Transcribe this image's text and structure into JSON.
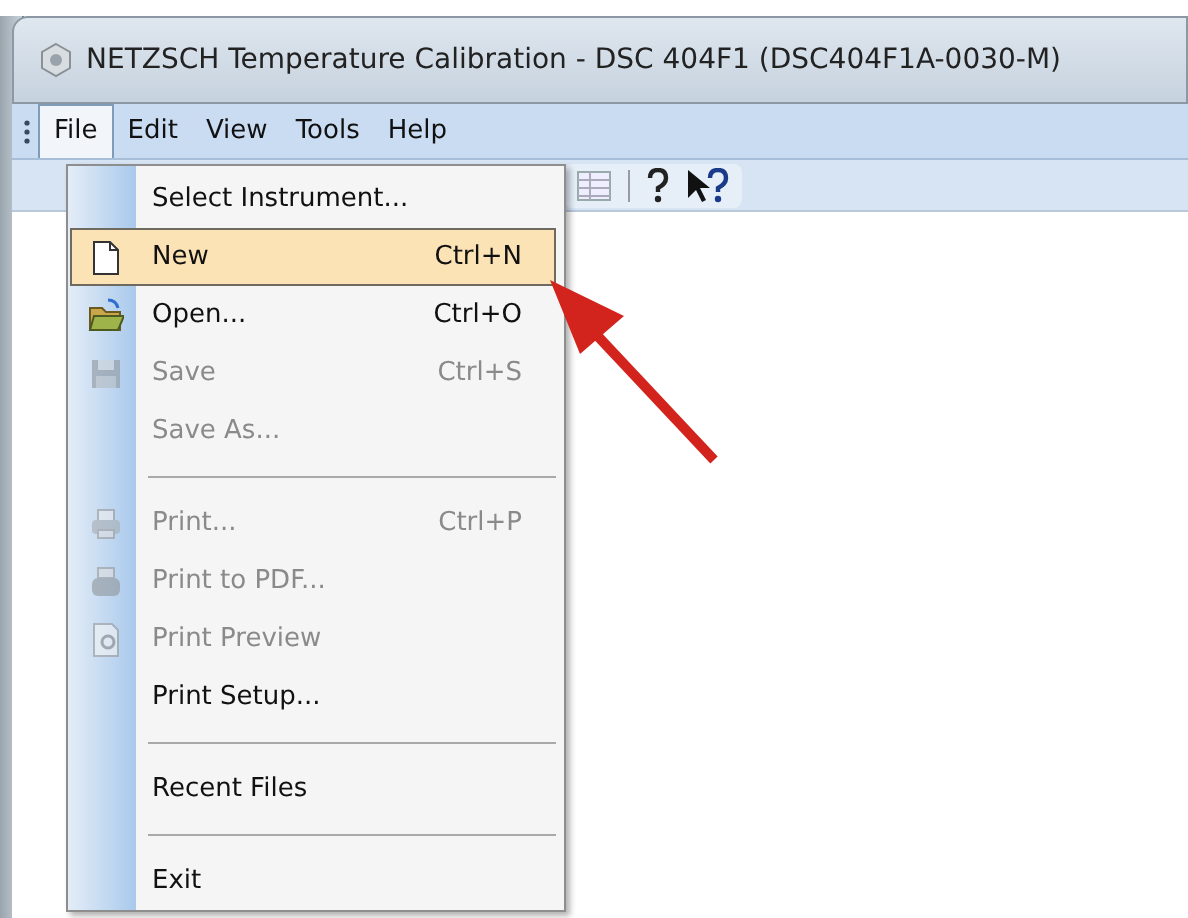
{
  "window": {
    "title": "NETZSCH Temperature Calibration - DSC 404F1 (DSC404F1A-0030-M)"
  },
  "menubar": [
    {
      "label": "File",
      "selected": true
    },
    {
      "label": "Edit",
      "selected": false
    },
    {
      "label": "View",
      "selected": false
    },
    {
      "label": "Tools",
      "selected": false
    },
    {
      "label": "Help",
      "selected": false
    }
  ],
  "file_menu": [
    {
      "kind": "item",
      "label": "Select Instrument...",
      "disabled": false,
      "selected": false
    },
    {
      "kind": "item",
      "label": "New",
      "shortcut": "Ctrl+N",
      "disabled": false,
      "selected": true
    },
    {
      "kind": "item",
      "label": "Open...",
      "shortcut": "Ctrl+O",
      "disabled": false,
      "selected": false
    },
    {
      "kind": "item",
      "label": "Save",
      "shortcut": "Ctrl+S",
      "disabled": true,
      "selected": false
    },
    {
      "kind": "item",
      "label": "Save As...",
      "disabled": true,
      "selected": false
    },
    {
      "kind": "separator"
    },
    {
      "kind": "item",
      "label": "Print...",
      "shortcut": "Ctrl+P",
      "disabled": true,
      "selected": false
    },
    {
      "kind": "item",
      "label": "Print to PDF...",
      "disabled": true,
      "selected": false
    },
    {
      "kind": "item",
      "label": "Print Preview",
      "disabled": true,
      "selected": false
    },
    {
      "kind": "item",
      "label": "Print Setup...",
      "disabled": false,
      "selected": false
    },
    {
      "kind": "separator"
    },
    {
      "kind": "item",
      "label": "Recent Files",
      "disabled": false,
      "selected": false
    },
    {
      "kind": "separator"
    },
    {
      "kind": "item",
      "label": "Exit",
      "disabled": false,
      "selected": false
    }
  ]
}
